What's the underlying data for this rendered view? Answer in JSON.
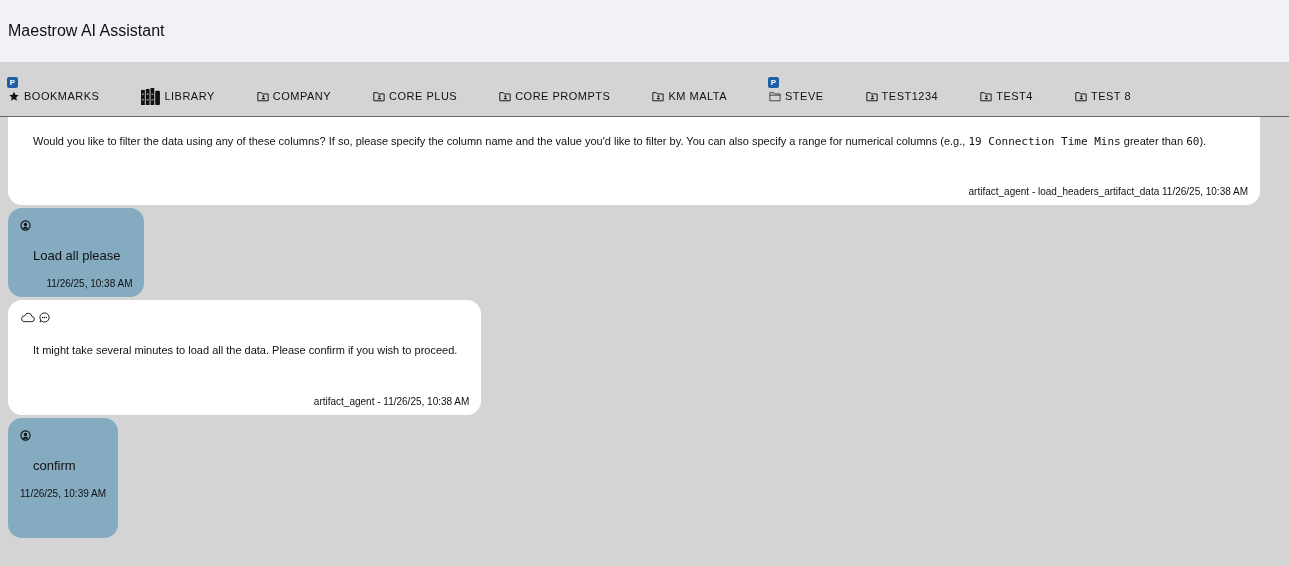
{
  "header": {
    "title": "Maestrow AI Assistant"
  },
  "tabs": [
    {
      "label": "BOOKMARKS",
      "kind": "star",
      "badge": "P"
    },
    {
      "label": "LIBRARY",
      "kind": "books"
    },
    {
      "label": "COMPANY",
      "kind": "shared"
    },
    {
      "label": "CORE PLUS",
      "kind": "shared"
    },
    {
      "label": "CORE PROMPTS",
      "kind": "shared"
    },
    {
      "label": "KM MALTA",
      "kind": "shared"
    },
    {
      "label": "STEVE",
      "kind": "folder",
      "badge": "P"
    },
    {
      "label": "TEST1234",
      "kind": "shared"
    },
    {
      "label": "TEST4",
      "kind": "shared"
    },
    {
      "label": "TEST 8",
      "kind": "shared"
    }
  ],
  "messages": [
    {
      "kind": "agent",
      "cut_top": true,
      "segments": [
        {
          "text": "Would you like to filter the data using any of these columns? If so, please specify the column name and the value you'd like to filter by. You can also specify a range for numerical columns (e.g., ",
          "kind": "text"
        },
        {
          "text": "19 Connection Time Mins",
          "kind": "code"
        },
        {
          "text": " greater than ",
          "kind": "text"
        },
        {
          "text": "60",
          "kind": "code"
        },
        {
          "text": ").",
          "kind": "text"
        }
      ],
      "footer": "artifact_agent - load_headers_artifact_data 11/26/25, 10:38 AM"
    },
    {
      "kind": "user",
      "segments": [
        {
          "text": "Load all please",
          "kind": "text"
        }
      ],
      "footer": "11/26/25, 10:38 AM"
    },
    {
      "kind": "agent",
      "segments": [
        {
          "text": "It might take several minutes to load all the data. Please confirm if you wish to proceed.",
          "kind": "text"
        }
      ],
      "footer": "artifact_agent -  11/26/25, 10:38 AM"
    },
    {
      "kind": "user",
      "segments": [
        {
          "text": "confirm",
          "kind": "text"
        }
      ],
      "footer": "11/26/25, 10:39 AM"
    }
  ]
}
